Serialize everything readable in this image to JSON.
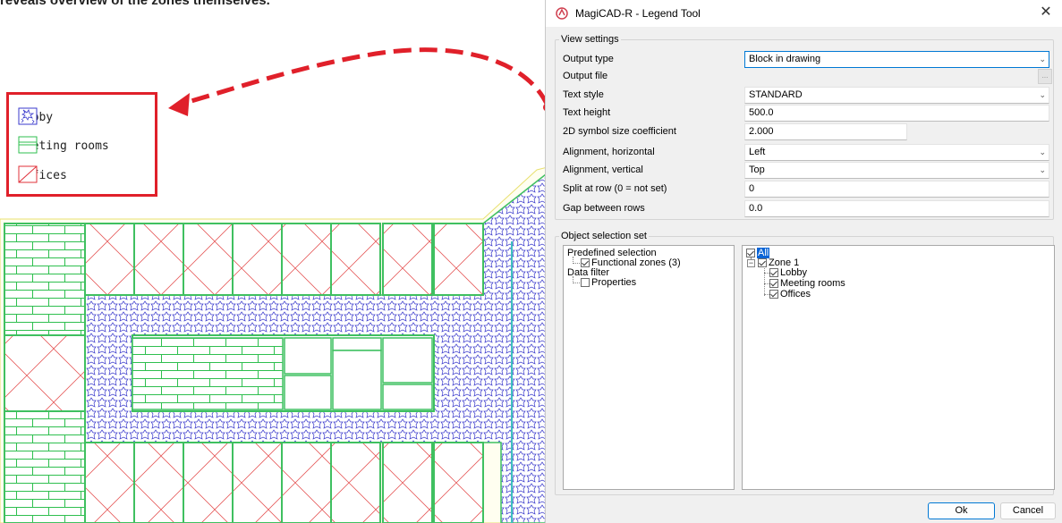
{
  "background": {
    "top_text": "reveals overview of the zones themselves."
  },
  "legend": {
    "items": [
      {
        "label": "Lobby"
      },
      {
        "label": "Meeting rooms"
      },
      {
        "label": "Offices"
      }
    ],
    "border_color": "#e0202a"
  },
  "dialog": {
    "title": "MagiCAD-R - Legend Tool",
    "view_settings": {
      "group_label": "View settings",
      "rows": [
        {
          "label": "Output type",
          "value": "Block in drawing",
          "type": "select"
        },
        {
          "label": "Output file",
          "value": "",
          "type": "file"
        },
        {
          "label": "Text style",
          "value": "STANDARD",
          "type": "select"
        },
        {
          "label": "Text height",
          "value": "500.0",
          "type": "text"
        },
        {
          "label": "2D symbol size coefficient",
          "value": "2.000",
          "type": "text"
        },
        {
          "label": "Alignment, horizontal",
          "value": "Left",
          "type": "select"
        },
        {
          "label": "Alignment, vertical",
          "value": "Top",
          "type": "select"
        },
        {
          "label": "Split at row (0 = not set)",
          "value": "0",
          "type": "text"
        },
        {
          "label": "Gap between rows",
          "value": "0.0",
          "type": "text"
        }
      ],
      "browse_label": "..."
    },
    "object_selection": {
      "group_label": "Object selection set",
      "left_tree": {
        "predefined": "Predefined selection",
        "functional_zones": "Functional zones (3)",
        "data_filter": "Data filter",
        "properties": "Properties"
      },
      "right_tree": {
        "all": "All",
        "zone": "Zone 1",
        "children": [
          "Lobby",
          "Meeting rooms",
          "Offices"
        ]
      }
    },
    "buttons": {
      "ok": "Ok",
      "cancel": "Cancel"
    },
    "accent_color": "#0078d4"
  }
}
